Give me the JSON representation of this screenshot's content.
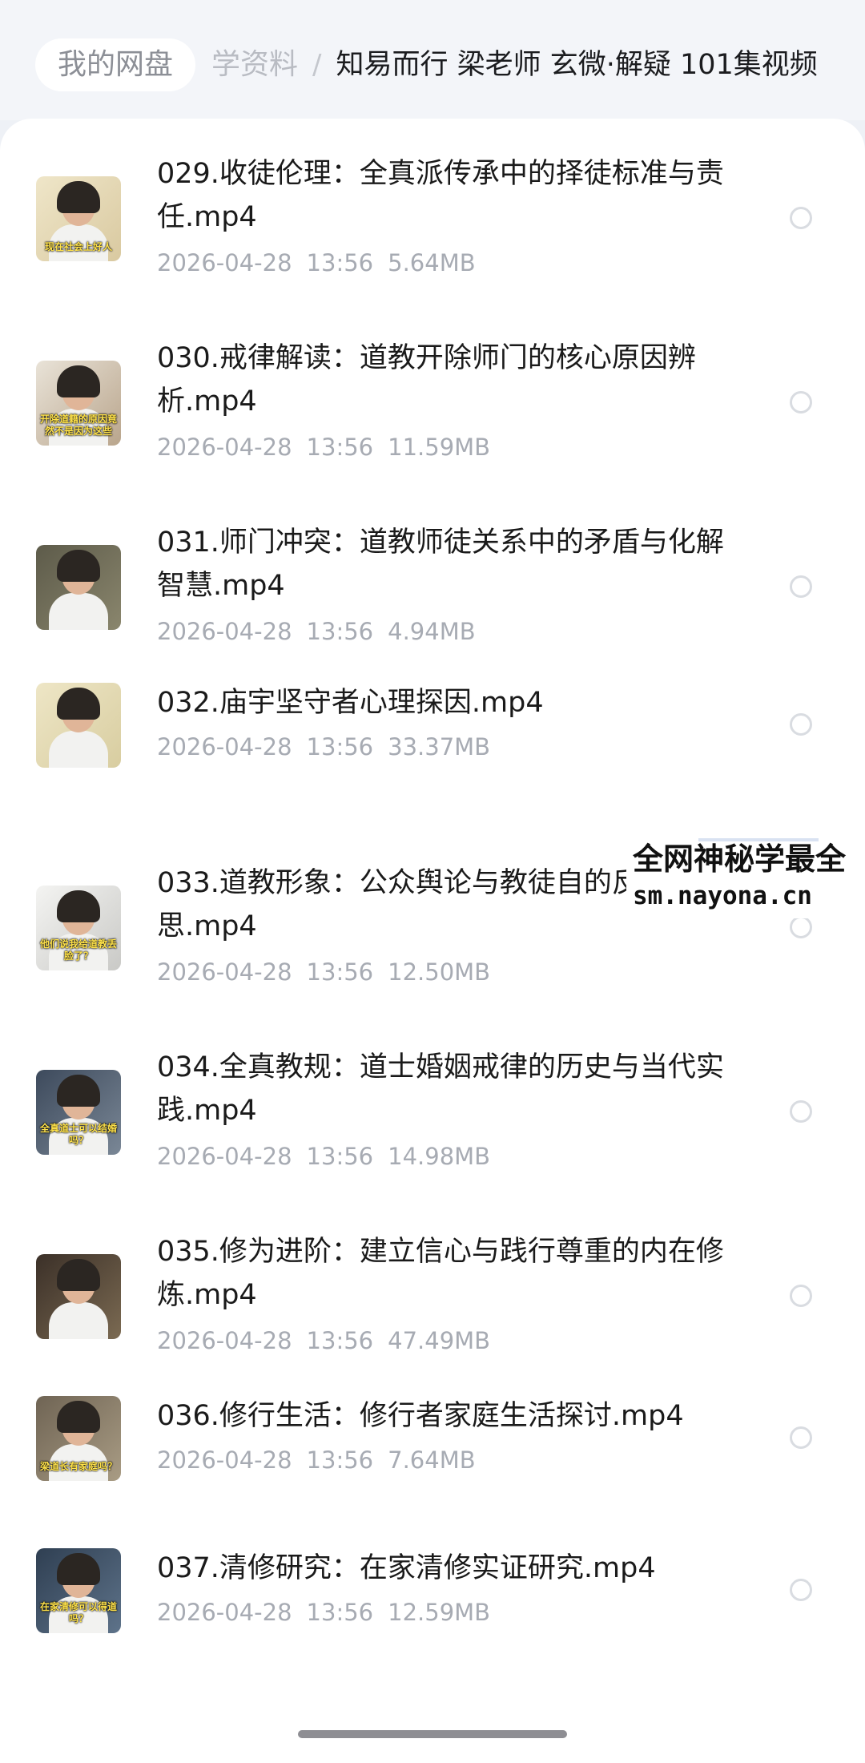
{
  "breadcrumb": {
    "root": "我的网盘",
    "middle": "学资料",
    "separator": "/",
    "current": "知易而行 梁老师 玄微·解疑 101集视频"
  },
  "files": [
    {
      "title": "029.收徒伦理：全真派传承中的择徒标准与责任.mp4",
      "date": "2026-04-28",
      "time": "13:56",
      "size": "5.64MB",
      "thumb_caption": "现在社会上好人"
    },
    {
      "title": "030.戒律解读：道教开除师门的核心原因辨析.mp4",
      "date": "2026-04-28",
      "time": "13:56",
      "size": "11.59MB",
      "thumb_caption": "开除道籍的原因竟然不是因为这些"
    },
    {
      "title": "031.师门冲突：道教师徒关系中的矛盾与化解智慧.mp4",
      "date": "2026-04-28",
      "time": "13:56",
      "size": "4.94MB",
      "thumb_caption": ""
    },
    {
      "title": "032.庙宇坚守者心理探因.mp4",
      "date": "2026-04-28",
      "time": "13:56",
      "size": "33.37MB",
      "thumb_caption": ""
    },
    {
      "title": "033.道教形象：公众舆论与教徒自的反思.mp4",
      "date": "2026-04-28",
      "time": "13:56",
      "size": "12.50MB",
      "thumb_caption": "他们说我给道教丢脸了？"
    },
    {
      "title": "034.全真教规：道士婚姻戒律的历史与当代实践.mp4",
      "date": "2026-04-28",
      "time": "13:56",
      "size": "14.98MB",
      "thumb_caption": "全真道士可以结婚吗？"
    },
    {
      "title": "035.修为进阶：建立信心与践行尊重的内在修炼.mp4",
      "date": "2026-04-28",
      "time": "13:56",
      "size": "47.49MB",
      "thumb_caption": ""
    },
    {
      "title": "036.修行生活：修行者家庭生活探讨.mp4",
      "date": "2026-04-28",
      "time": "13:56",
      "size": "7.64MB",
      "thumb_caption": "梁道长有家庭吗？"
    },
    {
      "title": "037.清修研究：在家清修实证研究.mp4",
      "date": "2026-04-28",
      "time": "13:56",
      "size": "12.59MB",
      "thumb_caption": "在家清修可以得道吗？"
    }
  ],
  "watermark": {
    "line1": "全网神秘学最全",
    "line2": "sm.nayona.cn"
  },
  "colors": {
    "accent_text": "#1a1a1a",
    "meta_text": "#a7abb3",
    "background": "#eef1f6"
  }
}
